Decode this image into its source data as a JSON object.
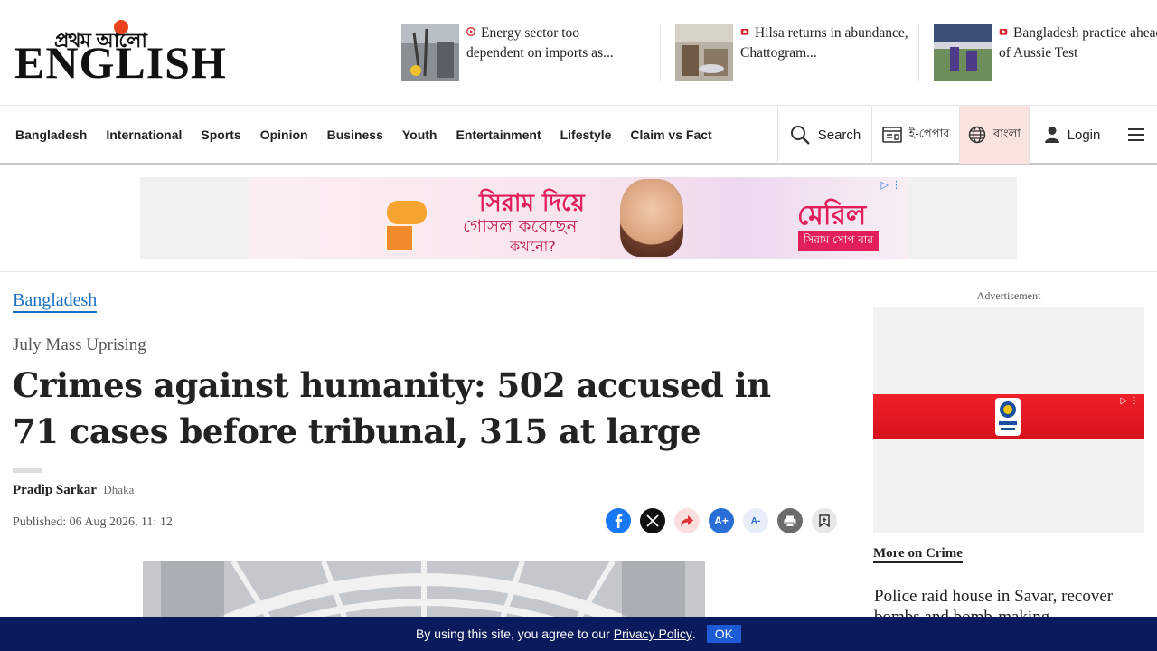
{
  "logo": {
    "bangla": "প্রথম আলো",
    "english": "ENGLISH"
  },
  "top_stories": [
    {
      "title": "Energy sector too dependent on imports as..."
    },
    {
      "title": "Hilsa returns in abundance, Chattogram..."
    },
    {
      "title": "Bangladesh practice ahead of Aussie Test"
    }
  ],
  "nav": {
    "items": [
      "Bangladesh",
      "International",
      "Sports",
      "Opinion",
      "Business",
      "Youth",
      "Entertainment",
      "Lifestyle",
      "Claim vs Fact"
    ],
    "search_label": "Search",
    "epaper_label": "ই-পেপার",
    "bangla_label": "বাংলা",
    "login_label": "Login"
  },
  "banner_ad": {
    "line1": "সিরাম দিয়ে",
    "line2": "গোসল করেছেন",
    "line3": "কখনো?",
    "brand": "মেরিল",
    "tag": "সিরাম সোপ বার"
  },
  "article": {
    "section": "Bangladesh",
    "kicker": "July Mass Uprising",
    "headline": "Crimes against humanity: 502 accused in 71 cases before tribunal, 315 at large",
    "author": "Pradip Sarkar",
    "location": "Dhaka",
    "published": "Published: 06 Aug 2026, 11: 12"
  },
  "sidebar": {
    "ad_label": "Advertisement",
    "more_label": "More on Crime",
    "story": "Police raid house in Savar, recover bombs and bomb-making"
  },
  "cookie": {
    "text": "By using this site, you agree to our",
    "link": "Privacy Policy",
    "suffix": ".",
    "ok": "OK"
  },
  "colors": {
    "accent": "#e21f5b",
    "link": "#1a70c5",
    "cookie_bg": "#0a1a5c"
  }
}
